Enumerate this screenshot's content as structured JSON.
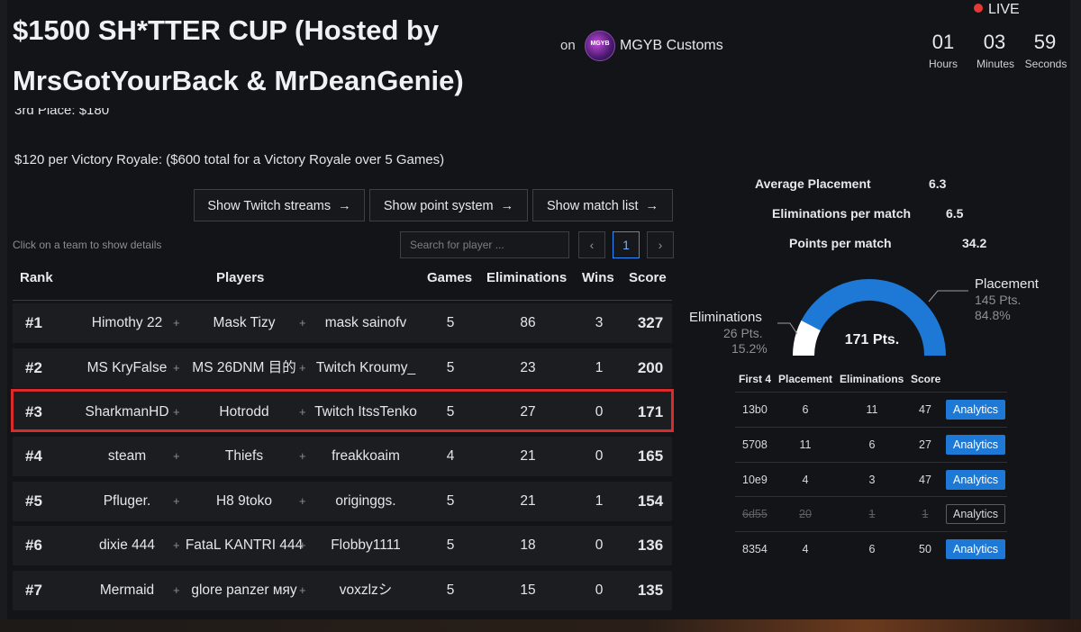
{
  "header": {
    "title": "$1500 SH*TTER CUP (Hosted by MrsGotYourBack & MrDeanGenie)",
    "on": "on",
    "org_logo_text": "MGYB",
    "org_name": "MGYB Customs"
  },
  "countdown": {
    "live": "LIVE",
    "hours": "01",
    "hours_label": "Hours",
    "minutes": "03",
    "minutes_label": "Minutes",
    "seconds": "59",
    "seconds_label": "Seconds"
  },
  "prizes": {
    "third": "3rd Place: $180",
    "victory": "$120 per Victory Royale: ($600 total for a Victory Royale over 5 Games)"
  },
  "buttons": {
    "twitch": "Show Twitch streams",
    "points": "Show point system",
    "matches": "Show match list",
    "arrow": "→"
  },
  "table": {
    "hint": "Click on a team to show details",
    "search_placeholder": "Search for player ...",
    "prev": "‹",
    "page": "1",
    "next": "›",
    "headers": {
      "rank": "Rank",
      "players": "Players",
      "games": "Games",
      "elims": "Eliminations",
      "wins": "Wins",
      "score": "Score"
    },
    "plus": "+",
    "rows": [
      {
        "rank": "#1",
        "p1": "Himothy 22",
        "p2": "Mask Tizy",
        "p3": "mask sainofv",
        "games": "5",
        "elims": "86",
        "wins": "3",
        "score": "327"
      },
      {
        "rank": "#2",
        "p1": "MS KryFalse",
        "p2": "MS 26DNM 目的",
        "p3": "Twitch Kroumy_",
        "games": "5",
        "elims": "23",
        "wins": "1",
        "score": "200"
      },
      {
        "rank": "#3",
        "p1": "SharkmanHD",
        "p2": "Hotrodd",
        "p3": "Twitch ItssTenko",
        "games": "5",
        "elims": "27",
        "wins": "0",
        "score": "171"
      },
      {
        "rank": "#4",
        "p1": "steam",
        "p2": "Thiefs",
        "p3": "freakkoaim",
        "games": "4",
        "elims": "21",
        "wins": "0",
        "score": "165"
      },
      {
        "rank": "#5",
        "p1": "Pfluger.",
        "p2": "H8 9toko",
        "p3": "originggs.",
        "games": "5",
        "elims": "21",
        "wins": "1",
        "score": "154"
      },
      {
        "rank": "#6",
        "p1": "dixie 444",
        "p2": "FataL KANTRI 444",
        "p3": "Flobby1111",
        "games": "5",
        "elims": "18",
        "wins": "0",
        "score": "136"
      },
      {
        "rank": "#7",
        "p1": "Mermaid",
        "p2": "glore panzer мяу",
        "p3": "voxzlzシ",
        "games": "5",
        "elims": "15",
        "wins": "0",
        "score": "135"
      }
    ]
  },
  "stats": {
    "avg_placement_label": "Average Placement",
    "avg_placement": "6.3",
    "elims_label": "Eliminations per match",
    "elims": "6.5",
    "points_label": "Points per match",
    "points": "34.2"
  },
  "gauge": {
    "total": "171 Pts.",
    "elims_label": "Eliminations",
    "elims_pts": "26 Pts.",
    "elims_pct": "15.2%",
    "placement_label": "Placement",
    "placement_pts": "145 Pts.",
    "placement_pct": "84.8%",
    "placement_fraction": 0.848,
    "placement_color": "#1e78d6",
    "elims_color": "#ffffff"
  },
  "matches": {
    "headers": {
      "id": "First 4",
      "placement": "Placement",
      "elims": "Eliminations",
      "score": "Score"
    },
    "analytics": "Analytics",
    "rows": [
      {
        "id": "13b0",
        "placement": "6",
        "elims": "11",
        "score": "47",
        "dim": false
      },
      {
        "id": "5708",
        "placement": "11",
        "elims": "6",
        "score": "27",
        "dim": false
      },
      {
        "id": "10e9",
        "placement": "4",
        "elims": "3",
        "score": "47",
        "dim": false
      },
      {
        "id": "6d55",
        "placement": "20",
        "elims": "1",
        "score": "1",
        "dim": true
      },
      {
        "id": "8354",
        "placement": "4",
        "elims": "6",
        "score": "50",
        "dim": false
      }
    ]
  }
}
